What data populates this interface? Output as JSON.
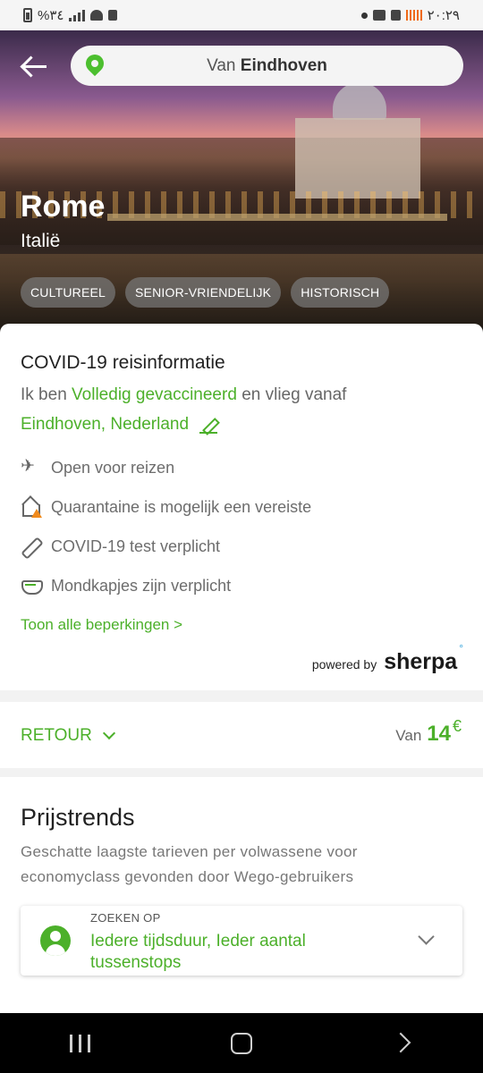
{
  "status_bar": {
    "left_text": "%٣٤",
    "time": "٢٠:٢٩"
  },
  "header": {
    "search_prefix": "Van",
    "search_city": "Eindhoven"
  },
  "destination": {
    "city": "Rome",
    "country": "Italië",
    "tags": [
      "CULTUREEL",
      "SENIOR-VRIENDELIJK",
      "HISTORISCH"
    ]
  },
  "covid": {
    "title": "COVID-19 reisinformatie",
    "line1_prefix": "Ik ben",
    "vaccination_status": "Volledig gevaccineerd",
    "line1_suffix": "en vlieg vanaf",
    "origin": "Eindhoven, Nederland",
    "restrictions": [
      {
        "icon": "plane-check-icon",
        "text": "Open voor reizen"
      },
      {
        "icon": "house-warning-icon",
        "text": "Quarantaine is mogelijk een vereiste"
      },
      {
        "icon": "test-tube-icon",
        "text": "COVID-19 test verplicht"
      },
      {
        "icon": "mask-icon",
        "text": "Mondkapjes zijn verplicht"
      }
    ],
    "show_all_link": "Toon alle beperkingen >",
    "powered_by": "powered by",
    "brand": "sherpa"
  },
  "trip": {
    "type_label": "RETOUR",
    "price_prefix": "Van",
    "price_amount": "14",
    "price_currency": "€"
  },
  "trends": {
    "title": "Prijstrends",
    "subtitle": "Geschatte laagste tarieven per volwassene voor economyclass gevonden door Wego-gebruikers",
    "filter_label": "ZOEKEN OP",
    "filter_value": "Iedere tijdsduur, Ieder aantal tussenstops"
  },
  "colors": {
    "accent_green": "#4cb02a",
    "warning_orange": "#f08a1c",
    "sherpa_blue": "#2b9fd9"
  }
}
